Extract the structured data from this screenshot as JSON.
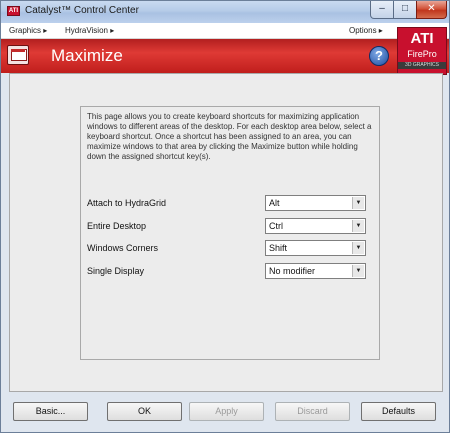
{
  "window": {
    "title": "Catalyst™ Control Center",
    "app_icon_text": "ATI",
    "min_glyph": "–",
    "max_glyph": "□",
    "close_glyph": "✕"
  },
  "menu": {
    "graphics": "Graphics ▸",
    "hydravision": "HydraVision ▸",
    "options": "Options ▸"
  },
  "banner": {
    "title": "Maximize",
    "help_glyph": "?",
    "logo_ati": "ATI",
    "logo_firepro": "FirePro",
    "logo_sub": "3D GRAPHICS"
  },
  "panel": {
    "description": "This page allows you to create keyboard shortcuts for maximizing application windows to different areas of the desktop. For each desktop area below, select a keyboard shortcut. Once a shortcut has been assigned to an area, you can maximize windows to that area by clicking the Maximize button while holding down the assigned shortcut key(s).",
    "rows": [
      {
        "label": "Attach to HydraGrid",
        "value": "Alt"
      },
      {
        "label": "Entire Desktop",
        "value": "Ctrl"
      },
      {
        "label": "Windows Corners",
        "value": "Shift"
      },
      {
        "label": "Single Display",
        "value": "No modifier"
      }
    ],
    "arrow_glyph": "▼"
  },
  "buttons": {
    "basic": "Basic...",
    "ok": "OK",
    "apply": "Apply",
    "discard": "Discard",
    "defaults": "Defaults"
  }
}
